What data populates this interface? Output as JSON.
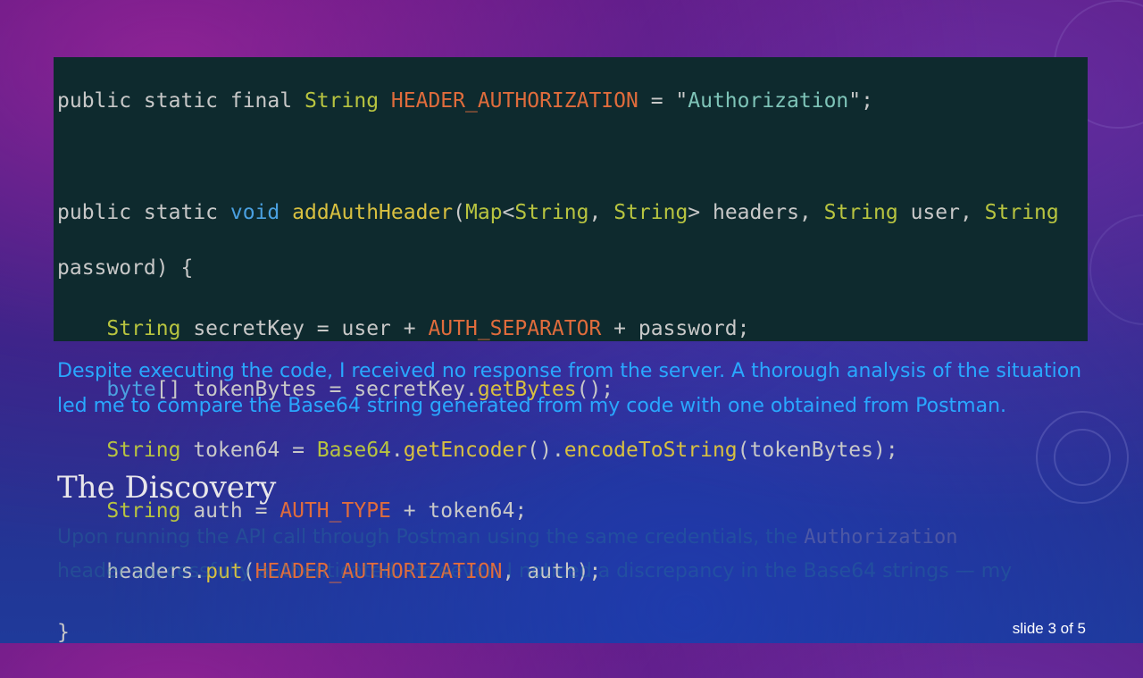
{
  "code": {
    "line1": [
      "public static final ",
      "String",
      " ",
      "HEADER_AUTHORIZATION",
      " = \"",
      "Authorization",
      "\";"
    ],
    "line2": [
      "public static ",
      "void",
      " ",
      "addAuthHeader",
      "(",
      "Map",
      "<",
      "String",
      ", ",
      "String",
      "> headers, ",
      "String",
      " user, ",
      "String"
    ],
    "line3": "password) {",
    "line4": [
      "    ",
      "String",
      " secretKey = user + ",
      "AUTH_SEPARATOR",
      " + password;"
    ],
    "line5": [
      "    ",
      "byte",
      "[] tokenBytes = secretKey.",
      "getBytes",
      "();"
    ],
    "line6": [
      "    ",
      "String",
      " token64 = ",
      "Base64",
      ".",
      "getEncoder",
      "().",
      "encodeToString",
      "(tokenBytes);"
    ],
    "line7": [
      "    ",
      "String",
      " auth = ",
      "AUTH_TYPE",
      " + token64;"
    ],
    "line8": [
      "    headers.",
      "put",
      "(",
      "HEADER_AUTHORIZATION",
      ", auth);"
    ],
    "line9": "}"
  },
  "paragraph": "Despite executing the code, I received no response from the server. A thorough analysis of the situation led me to compare the Base64 string generated from my code with one obtained from Postman.",
  "heading": "The Discovery",
  "faded": {
    "line1_a": "Upon running the API call through Postman using the same credentials, the ",
    "line1_code": "Authorization",
    "line2": "header successfully authenticated. However, I noticed a discrepancy in the Base64 strings — my"
  },
  "slide_indicator": "slide 3 of 5",
  "colors": {
    "code_bg": "#0e2a2e",
    "type": "#b8c440",
    "constant": "#e06c3c",
    "string": "#7ec4b8",
    "keyword_void": "#4aa0e0",
    "method": "#d8c040",
    "paragraph": "#29a8ff"
  }
}
